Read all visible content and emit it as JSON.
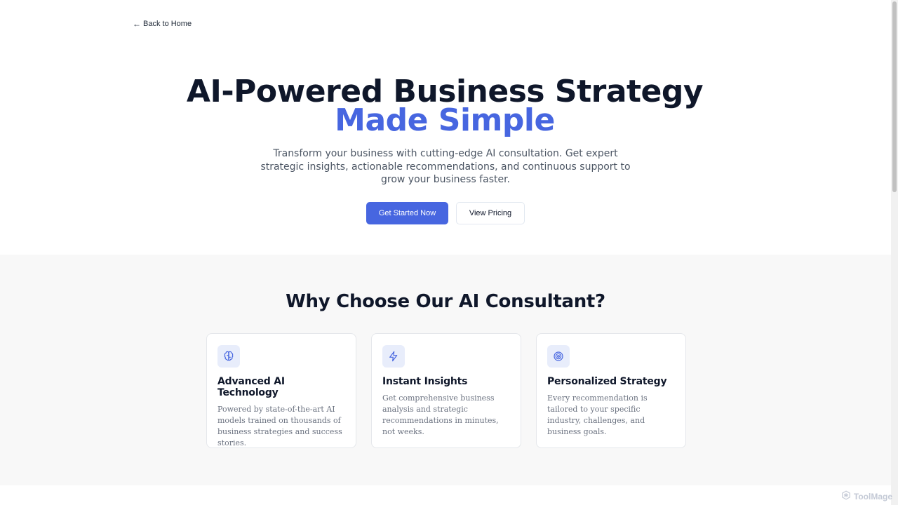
{
  "nav": {
    "back_label": "Back to Home"
  },
  "hero": {
    "title_line1": "AI-Powered Business Strategy",
    "title_line2": "Made Simple",
    "subtitle": "Transform your business with cutting-edge AI consultation. Get expert strategic insights, actionable recommendations, and continuous support to grow your business faster.",
    "primary_cta": "Get Started Now",
    "secondary_cta": "View Pricing"
  },
  "features": {
    "title": "Why Choose Our AI Consultant?",
    "cards": [
      {
        "icon": "brain-icon",
        "title": "Advanced AI Technology",
        "text": "Powered by state-of-the-art AI models trained on thousands of business strategies and success stories."
      },
      {
        "icon": "lightning-icon",
        "title": "Instant Insights",
        "text": "Get comprehensive business analysis and strategic recommendations in minutes, not weeks."
      },
      {
        "icon": "target-icon",
        "title": "Personalized Strategy",
        "text": "Every recommendation is tailored to your specific industry, challenges, and business goals."
      }
    ]
  },
  "watermark": {
    "text": "ToolMage"
  },
  "colors": {
    "accent": "#4766e0",
    "heading": "#0f172a",
    "muted": "#6b7280",
    "section_bg": "#f8f8f8"
  }
}
